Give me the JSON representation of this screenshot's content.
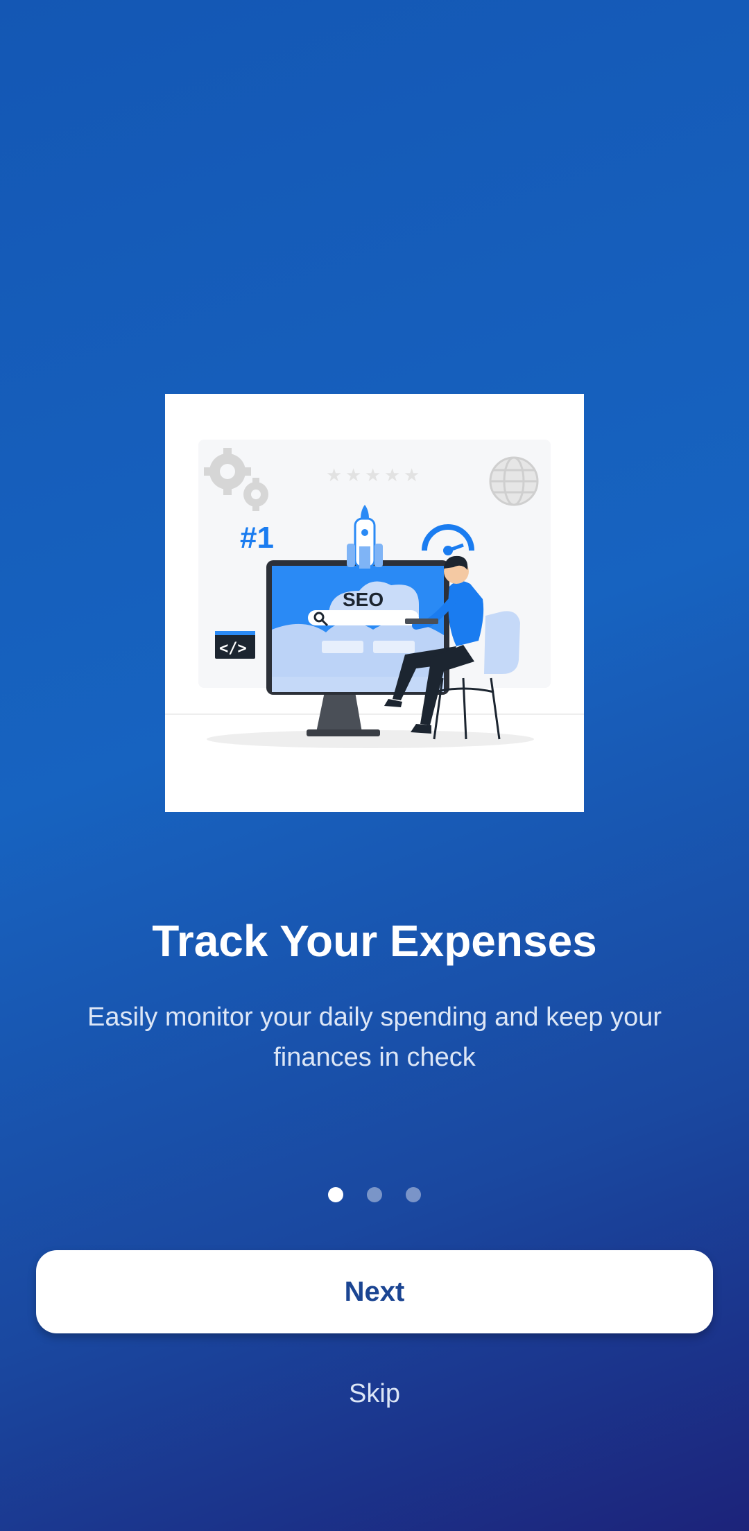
{
  "onboarding": {
    "illustration": {
      "badge_text": "#1",
      "screen_text": "SEO"
    },
    "title": "Track Your Expenses",
    "subtitle": "Easily monitor your daily spending and keep your finances in check",
    "page_indicator": {
      "current": 1,
      "total": 3
    },
    "next_label": "Next",
    "skip_label": "Skip"
  },
  "colors": {
    "background_top": "#1457b4",
    "background_bottom": "#1c237a",
    "button_bg": "#ffffff",
    "button_text": "#1b4592",
    "accent": "#1a7cf0"
  }
}
